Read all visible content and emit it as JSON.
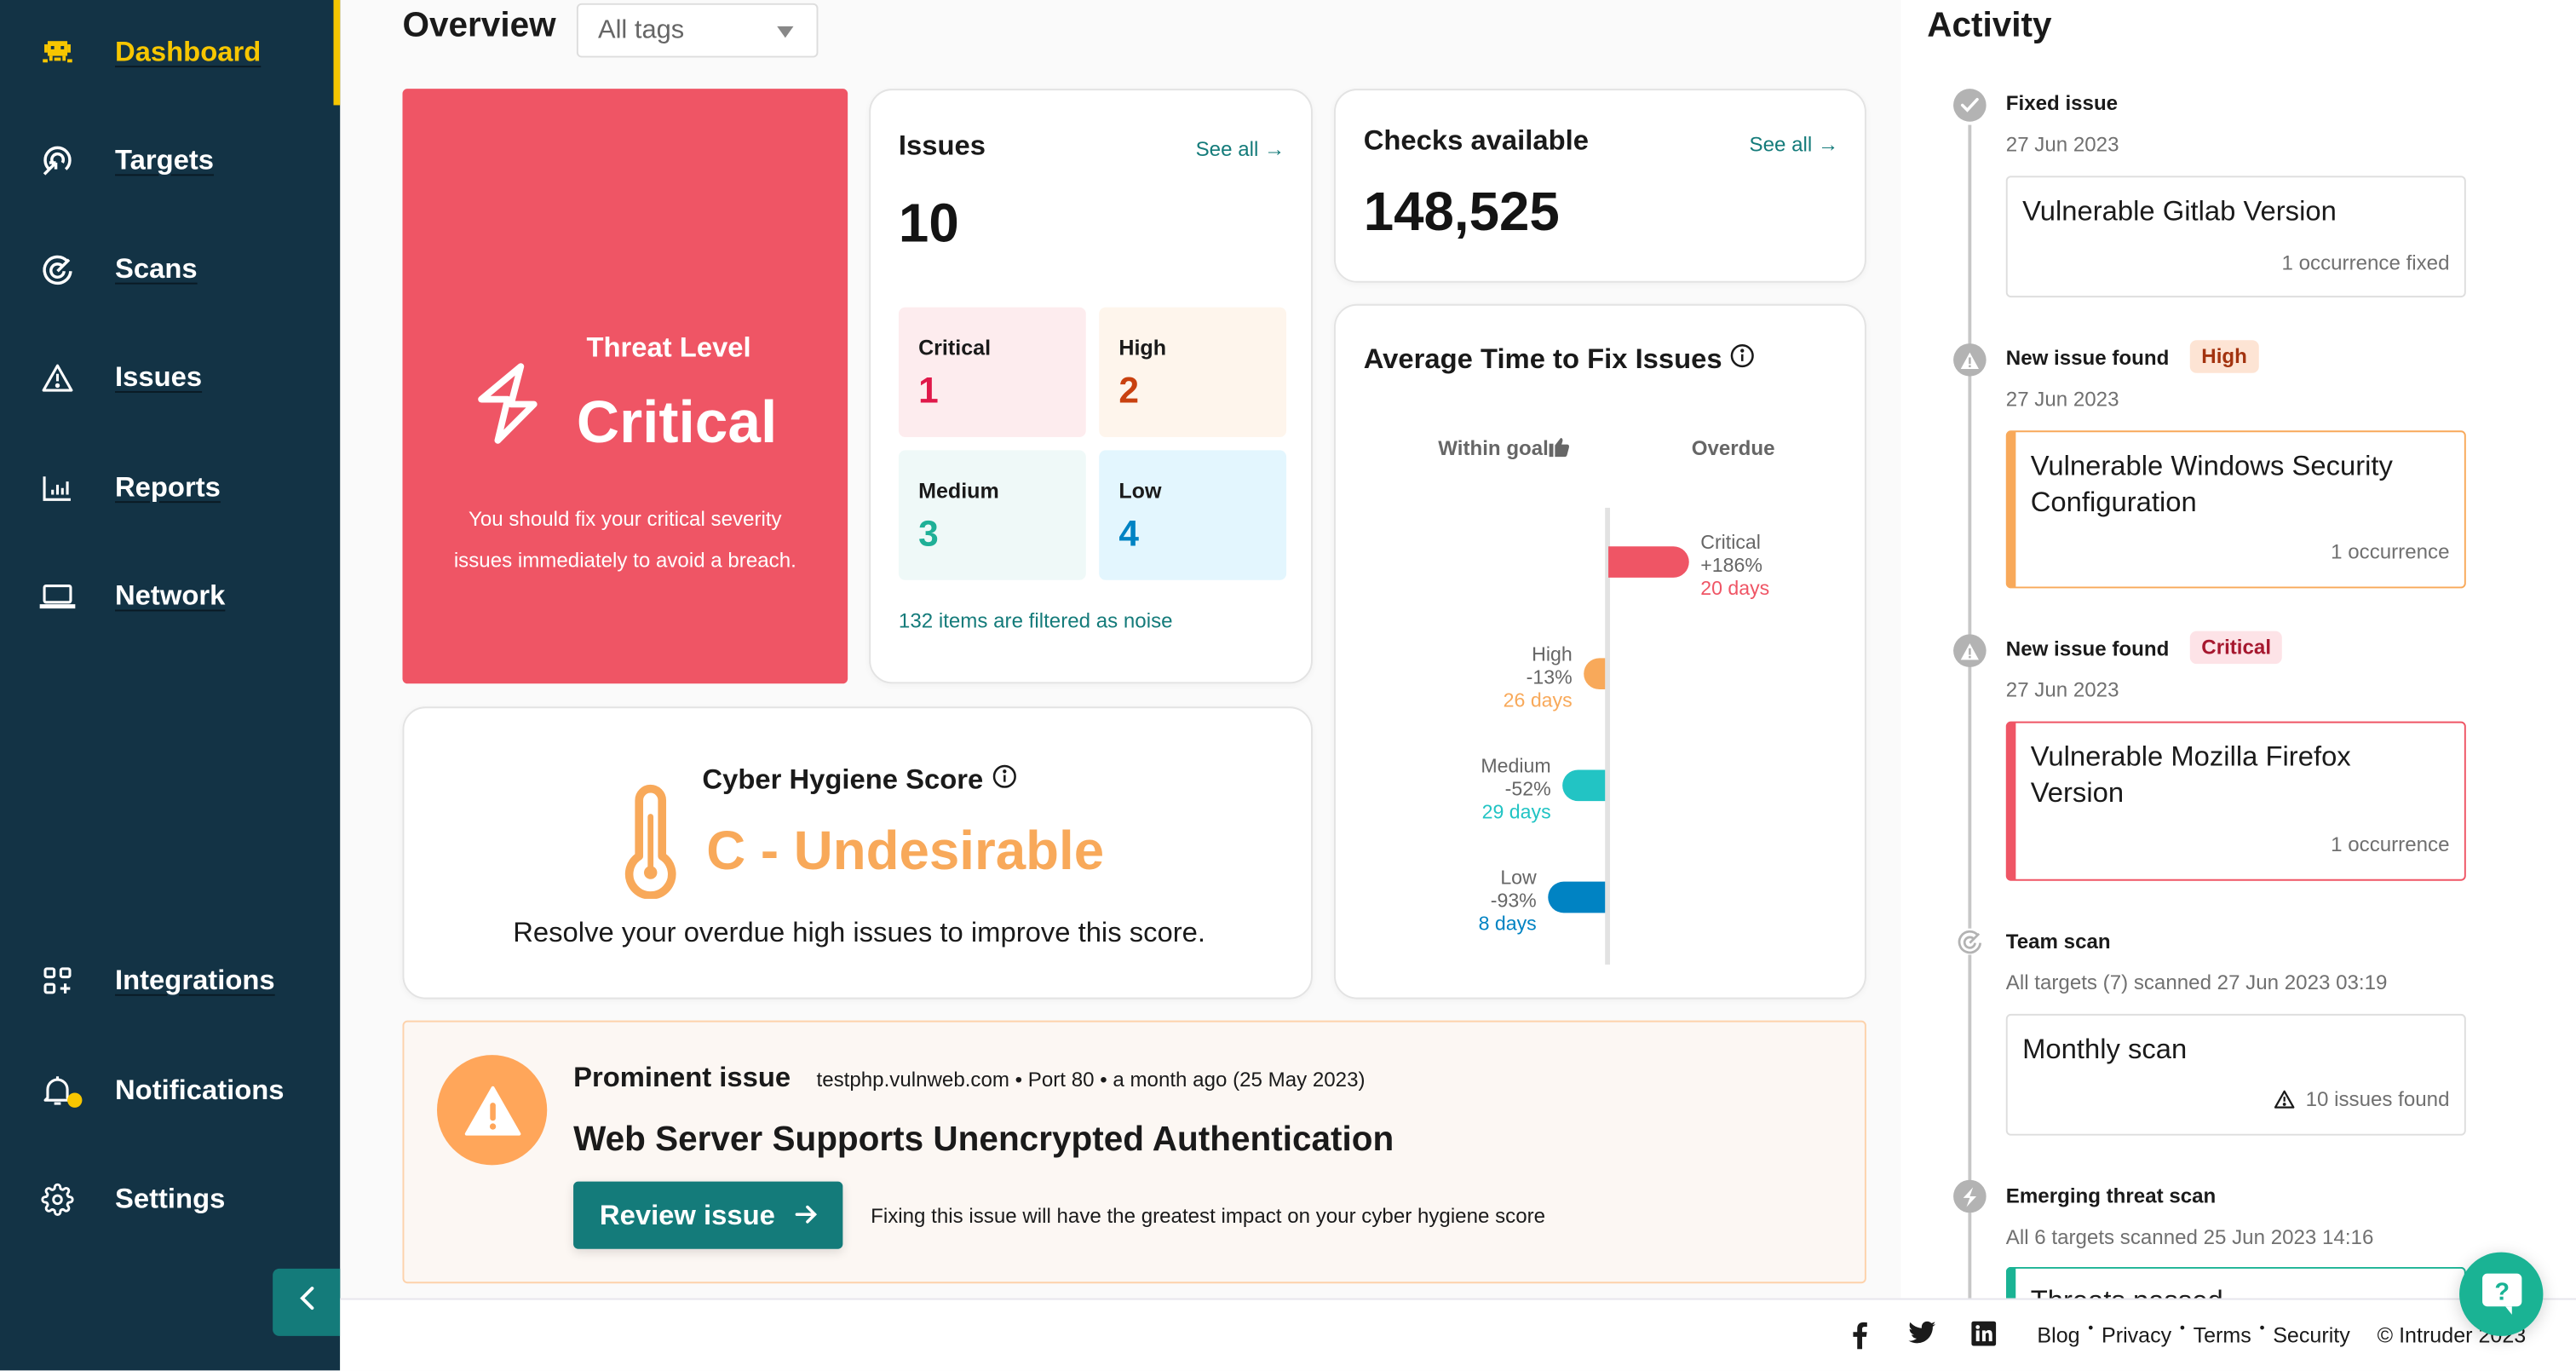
{
  "sidebar": {
    "items": [
      {
        "label": "Dashboard",
        "icon": "invader-icon",
        "active": true
      },
      {
        "label": "Targets",
        "icon": "target-pointer-icon"
      },
      {
        "label": "Scans",
        "icon": "radar-icon"
      },
      {
        "label": "Issues",
        "icon": "warning-triangle-icon"
      },
      {
        "label": "Reports",
        "icon": "bar-chart-icon"
      },
      {
        "label": "Network",
        "icon": "laptop-icon"
      }
    ],
    "bottom_items": [
      {
        "label": "Integrations",
        "icon": "integrations-icon"
      },
      {
        "label": "Notifications",
        "icon": "bell-icon",
        "has_dot": true
      },
      {
        "label": "Settings",
        "icon": "gear-icon"
      }
    ],
    "collapse_icon": "chevron-left-icon"
  },
  "header": {
    "title": "Overview",
    "tags_select": {
      "value": "All tags"
    }
  },
  "threat": {
    "label": "Threat Level",
    "value": "Critical",
    "description": "You should fix your critical severity issues immediately to avoid a breach.",
    "color": "#ef5565"
  },
  "issues": {
    "title": "Issues",
    "see_all": "See all →",
    "total": "10",
    "severities": [
      {
        "label": "Critical",
        "value": "1",
        "bg": "#fdecee",
        "color": "#e0194a"
      },
      {
        "label": "High",
        "value": "2",
        "bg": "#fef5ec",
        "color": "#c9410f"
      },
      {
        "label": "Medium",
        "value": "3",
        "bg": "#eff9f8",
        "color": "#1fb097"
      },
      {
        "label": "Low",
        "value": "4",
        "bg": "#e3f6fe",
        "color": "#0083c3"
      }
    ],
    "noise_text": "132 items are filtered as noise"
  },
  "checks": {
    "title": "Checks available",
    "see_all": "See all →",
    "value": "148,525"
  },
  "avg_fix": {
    "title": "Average Time to Fix Issues",
    "info_icon": "info-icon"
  },
  "chart_data": {
    "type": "bar",
    "orientation": "horizontal-diverging",
    "title": "Average Time to Fix Issues",
    "left_label": "Within goal",
    "right_label": "Overdue",
    "categories": [
      "Critical",
      "High",
      "Medium",
      "Low"
    ],
    "values": [
      186,
      -13,
      -52,
      -93
    ],
    "value_labels": [
      "+186%",
      "-13%",
      "-52%",
      "-93%"
    ],
    "days": [
      "20 days",
      "26 days",
      "29 days",
      "8 days"
    ],
    "colors": [
      "#ef5565",
      "#f8a95a",
      "#22c4c4",
      "#0083c3"
    ],
    "unit": "% vs goal",
    "grid": false
  },
  "hygiene": {
    "title": "Cyber Hygiene Score",
    "grade": "C - Undesirable",
    "advice": "Resolve your overdue high issues to improve this score.",
    "color": "#f8a95a"
  },
  "prominent": {
    "label": "Prominent issue",
    "meta": "testphp.vulnweb.com • Port 80 • a month ago (25 May 2023)",
    "title": "Web Server Supports Unencrypted Authentication",
    "button": "Review issue",
    "hint": "Fixing this issue will have the greatest impact on your cyber hygiene score"
  },
  "activity": {
    "title": "Activity",
    "events": [
      {
        "type": "Fixed issue",
        "icon": "check-icon",
        "date": "27 Jun 2023",
        "card_title": "Vulnerable Gitlab Version",
        "card_foot": "1 occurrence fixed"
      },
      {
        "type": "New issue found",
        "icon": "warning-icon",
        "badge": "High",
        "date": "27 Jun 2023",
        "card_title": "Vulnerable Windows Security Configuration",
        "card_foot": "1 occurrence"
      },
      {
        "type": "New issue found",
        "icon": "warning-icon",
        "badge": "Critical",
        "date": "27 Jun 2023",
        "card_title": "Vulnerable Mozilla Firefox Version",
        "card_foot": "1 occurrence"
      },
      {
        "type": "Team scan",
        "icon": "radar-icon",
        "date": "All targets (7) scanned 27 Jun 2023 03:19",
        "card_title": "Monthly scan",
        "card_foot": "10 issues found"
      },
      {
        "type": "Emerging threat scan",
        "icon": "bolt-icon",
        "date": "All 6 targets scanned 25 Jun 2023 14:16",
        "card_title": "Threats passed"
      }
    ]
  },
  "footer": {
    "social": [
      "facebook-icon",
      "twitter-icon",
      "linkedin-icon"
    ],
    "links": [
      "Blog",
      "Privacy",
      "Terms",
      "Security"
    ],
    "copyright": "© Intruder 2023"
  }
}
